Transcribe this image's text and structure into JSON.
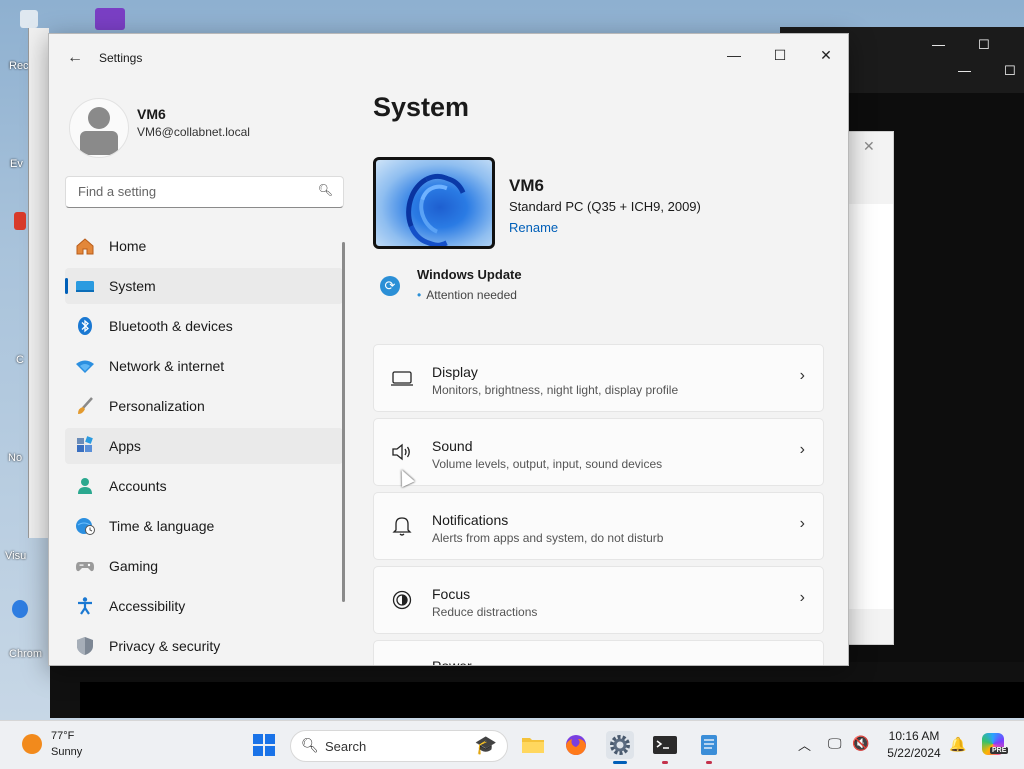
{
  "desktop": {
    "labels": [
      "Rec",
      "Ev",
      "C",
      "No",
      "Visu",
      "Chrom"
    ]
  },
  "window": {
    "title": "Settings",
    "controls": {
      "minimize": "—",
      "maximize": "☐",
      "close": "✕"
    }
  },
  "profile": {
    "name": "VM6",
    "email": "VM6@collabnet.local"
  },
  "search": {
    "placeholder": "Find a setting"
  },
  "nav": {
    "items": [
      {
        "label": "Home",
        "icon": "home-icon"
      },
      {
        "label": "System",
        "icon": "system-icon"
      },
      {
        "label": "Bluetooth & devices",
        "icon": "bluetooth-icon"
      },
      {
        "label": "Network & internet",
        "icon": "wifi-icon"
      },
      {
        "label": "Personalization",
        "icon": "brush-icon"
      },
      {
        "label": "Apps",
        "icon": "apps-icon"
      },
      {
        "label": "Accounts",
        "icon": "accounts-icon"
      },
      {
        "label": "Time & language",
        "icon": "globe-clock-icon"
      },
      {
        "label": "Gaming",
        "icon": "gamepad-icon"
      },
      {
        "label": "Accessibility",
        "icon": "accessibility-icon"
      },
      {
        "label": "Privacy & security",
        "icon": "shield-icon"
      }
    ],
    "selected": "System"
  },
  "main": {
    "title": "System",
    "device": {
      "name": "VM6",
      "model": "Standard PC (Q35 + ICH9, 2009)",
      "rename_label": "Rename"
    },
    "windows_update": {
      "title": "Windows Update",
      "status": "Attention needed"
    },
    "cards": [
      {
        "title": "Display",
        "desc": "Monitors, brightness, night light, display profile",
        "icon": "display-icon"
      },
      {
        "title": "Sound",
        "desc": "Volume levels, output, input, sound devices",
        "icon": "speaker-icon"
      },
      {
        "title": "Notifications",
        "desc": "Alerts from apps and system, do not disturb",
        "icon": "bell-icon"
      },
      {
        "title": "Focus",
        "desc": "Reduce distractions",
        "icon": "focus-icon"
      },
      {
        "title": "Power",
        "desc": "",
        "icon": "power-icon"
      }
    ]
  },
  "taskbar": {
    "weather": {
      "temp": "77°F",
      "condition": "Sunny"
    },
    "search_label": "Search",
    "clock": {
      "time": "10:16 AM",
      "date": "5/22/2024"
    },
    "copilot_badge": "PRE"
  }
}
